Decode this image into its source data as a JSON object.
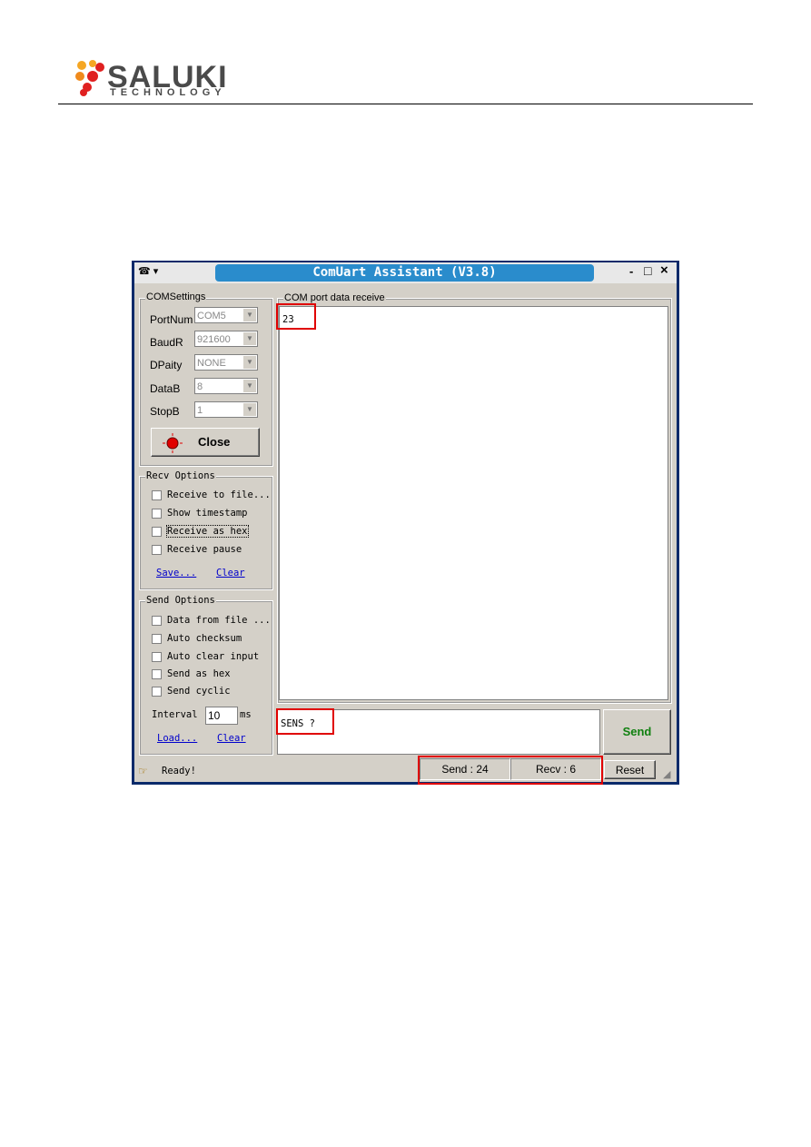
{
  "header": {
    "logo_name": "SALUKI",
    "logo_sub": "TECHNOLOGY"
  },
  "window": {
    "title": "ComUart Assistant (V3.8)",
    "controls": {
      "minimize": "-",
      "maximize": "□",
      "close": "×"
    },
    "com_settings": {
      "group_label": "COMSettings",
      "fields": [
        {
          "label": "PortNum",
          "value": "COM5"
        },
        {
          "label": "BaudR",
          "value": "921600"
        },
        {
          "label": "DPaity",
          "value": "NONE"
        },
        {
          "label": "DataB",
          "value": "8"
        },
        {
          "label": "StopB",
          "value": "1"
        }
      ],
      "close_button": "Close",
      "status_led_color": "#e00000"
    },
    "recv_options": {
      "group_label": "Recv Options",
      "items": [
        {
          "label": "Receive to file...",
          "checked": false
        },
        {
          "label": "Show timestamp",
          "checked": false
        },
        {
          "label": "Receive as hex",
          "checked": false
        },
        {
          "label": "Receive pause",
          "checked": false
        }
      ],
      "save_link": "Save...",
      "clear_link": "Clear"
    },
    "send_options": {
      "group_label": "Send Options",
      "items": [
        {
          "label": "Data from file ...",
          "checked": false
        },
        {
          "label": "Auto checksum",
          "checked": false
        },
        {
          "label": "Auto clear input",
          "checked": false
        },
        {
          "label": "Send as hex",
          "checked": false
        },
        {
          "label": "Send cyclic",
          "checked": false
        }
      ],
      "interval_label": "Interval",
      "interval_value": "10",
      "interval_unit": "ms",
      "load_link": "Load...",
      "clear_link": "Clear"
    },
    "receive": {
      "group_label": "COM port data receive",
      "content": "23"
    },
    "send": {
      "input_value": "SENS ?",
      "button": "Send",
      "button_color": "#108010"
    },
    "status": {
      "text": "Ready!",
      "send_count": "Send : 24",
      "recv_count": "Recv : 6",
      "reset_button": "Reset"
    },
    "highlight_color": "#e00000"
  }
}
